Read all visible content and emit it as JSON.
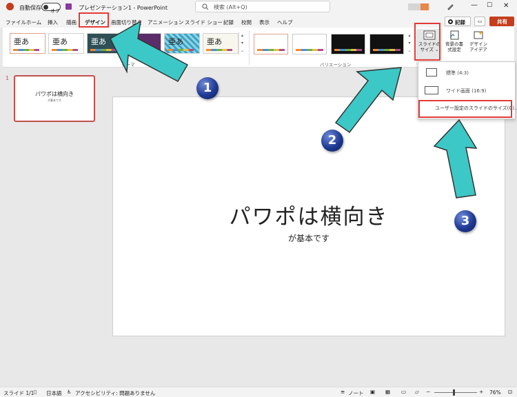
{
  "titlebar": {
    "autosave_label": "自動保存",
    "autosave_state": "オフ",
    "doc_title": "プレゼンテーション1 - PowerPoint",
    "search_placeholder": "検索 (Alt+Q)"
  },
  "tabs": [
    "ファイル",
    "ホーム",
    "挿入",
    "描画",
    "デザイン",
    "画面切り替え",
    "アニメーション",
    "スライド ショー",
    "記録",
    "校閲",
    "表示",
    "ヘルプ"
  ],
  "active_tab": "デザイン",
  "ribbon_right": {
    "record_label": "記録",
    "share_label": "共有"
  },
  "ribbon": {
    "themes": [
      "亜あ",
      "亜あ",
      "亜あ",
      "亜あ",
      "亜あ"
    ],
    "theme_group_label": "テーマ",
    "variation_group_label": "バリエーション",
    "slide_size_button": [
      "スライドの",
      "サイズ ⌄"
    ],
    "bg_format_button": [
      "背景の書",
      "式設定"
    ],
    "design_ideas_button": [
      "デザイン",
      "アイデア"
    ]
  },
  "dropdown": {
    "items": [
      "標準 (4:3)",
      "ワイド画面 (16:9)",
      "ユーザー設定のスライドのサイズ(C)..."
    ]
  },
  "thumbnails": {
    "slide_number": "1",
    "title": "パワポは横向き",
    "subtitle": "が基本です"
  },
  "slide": {
    "title": "パワポは横向き",
    "subtitle": "が基本です"
  },
  "statusbar": {
    "slide_count": "スライド 1/1",
    "language": "日本語",
    "accessibility": "アクセシビリティ: 問題ありません",
    "notes": "ノート",
    "zoom": "76%"
  },
  "annotations": {
    "step1": "1",
    "step2": "2",
    "step3": "3"
  },
  "colors": {
    "accent_red": "#e53935",
    "arrow_teal": "#3cc8c6",
    "badge_blue": "#1f3a93",
    "share_button": "#c43e1c"
  }
}
